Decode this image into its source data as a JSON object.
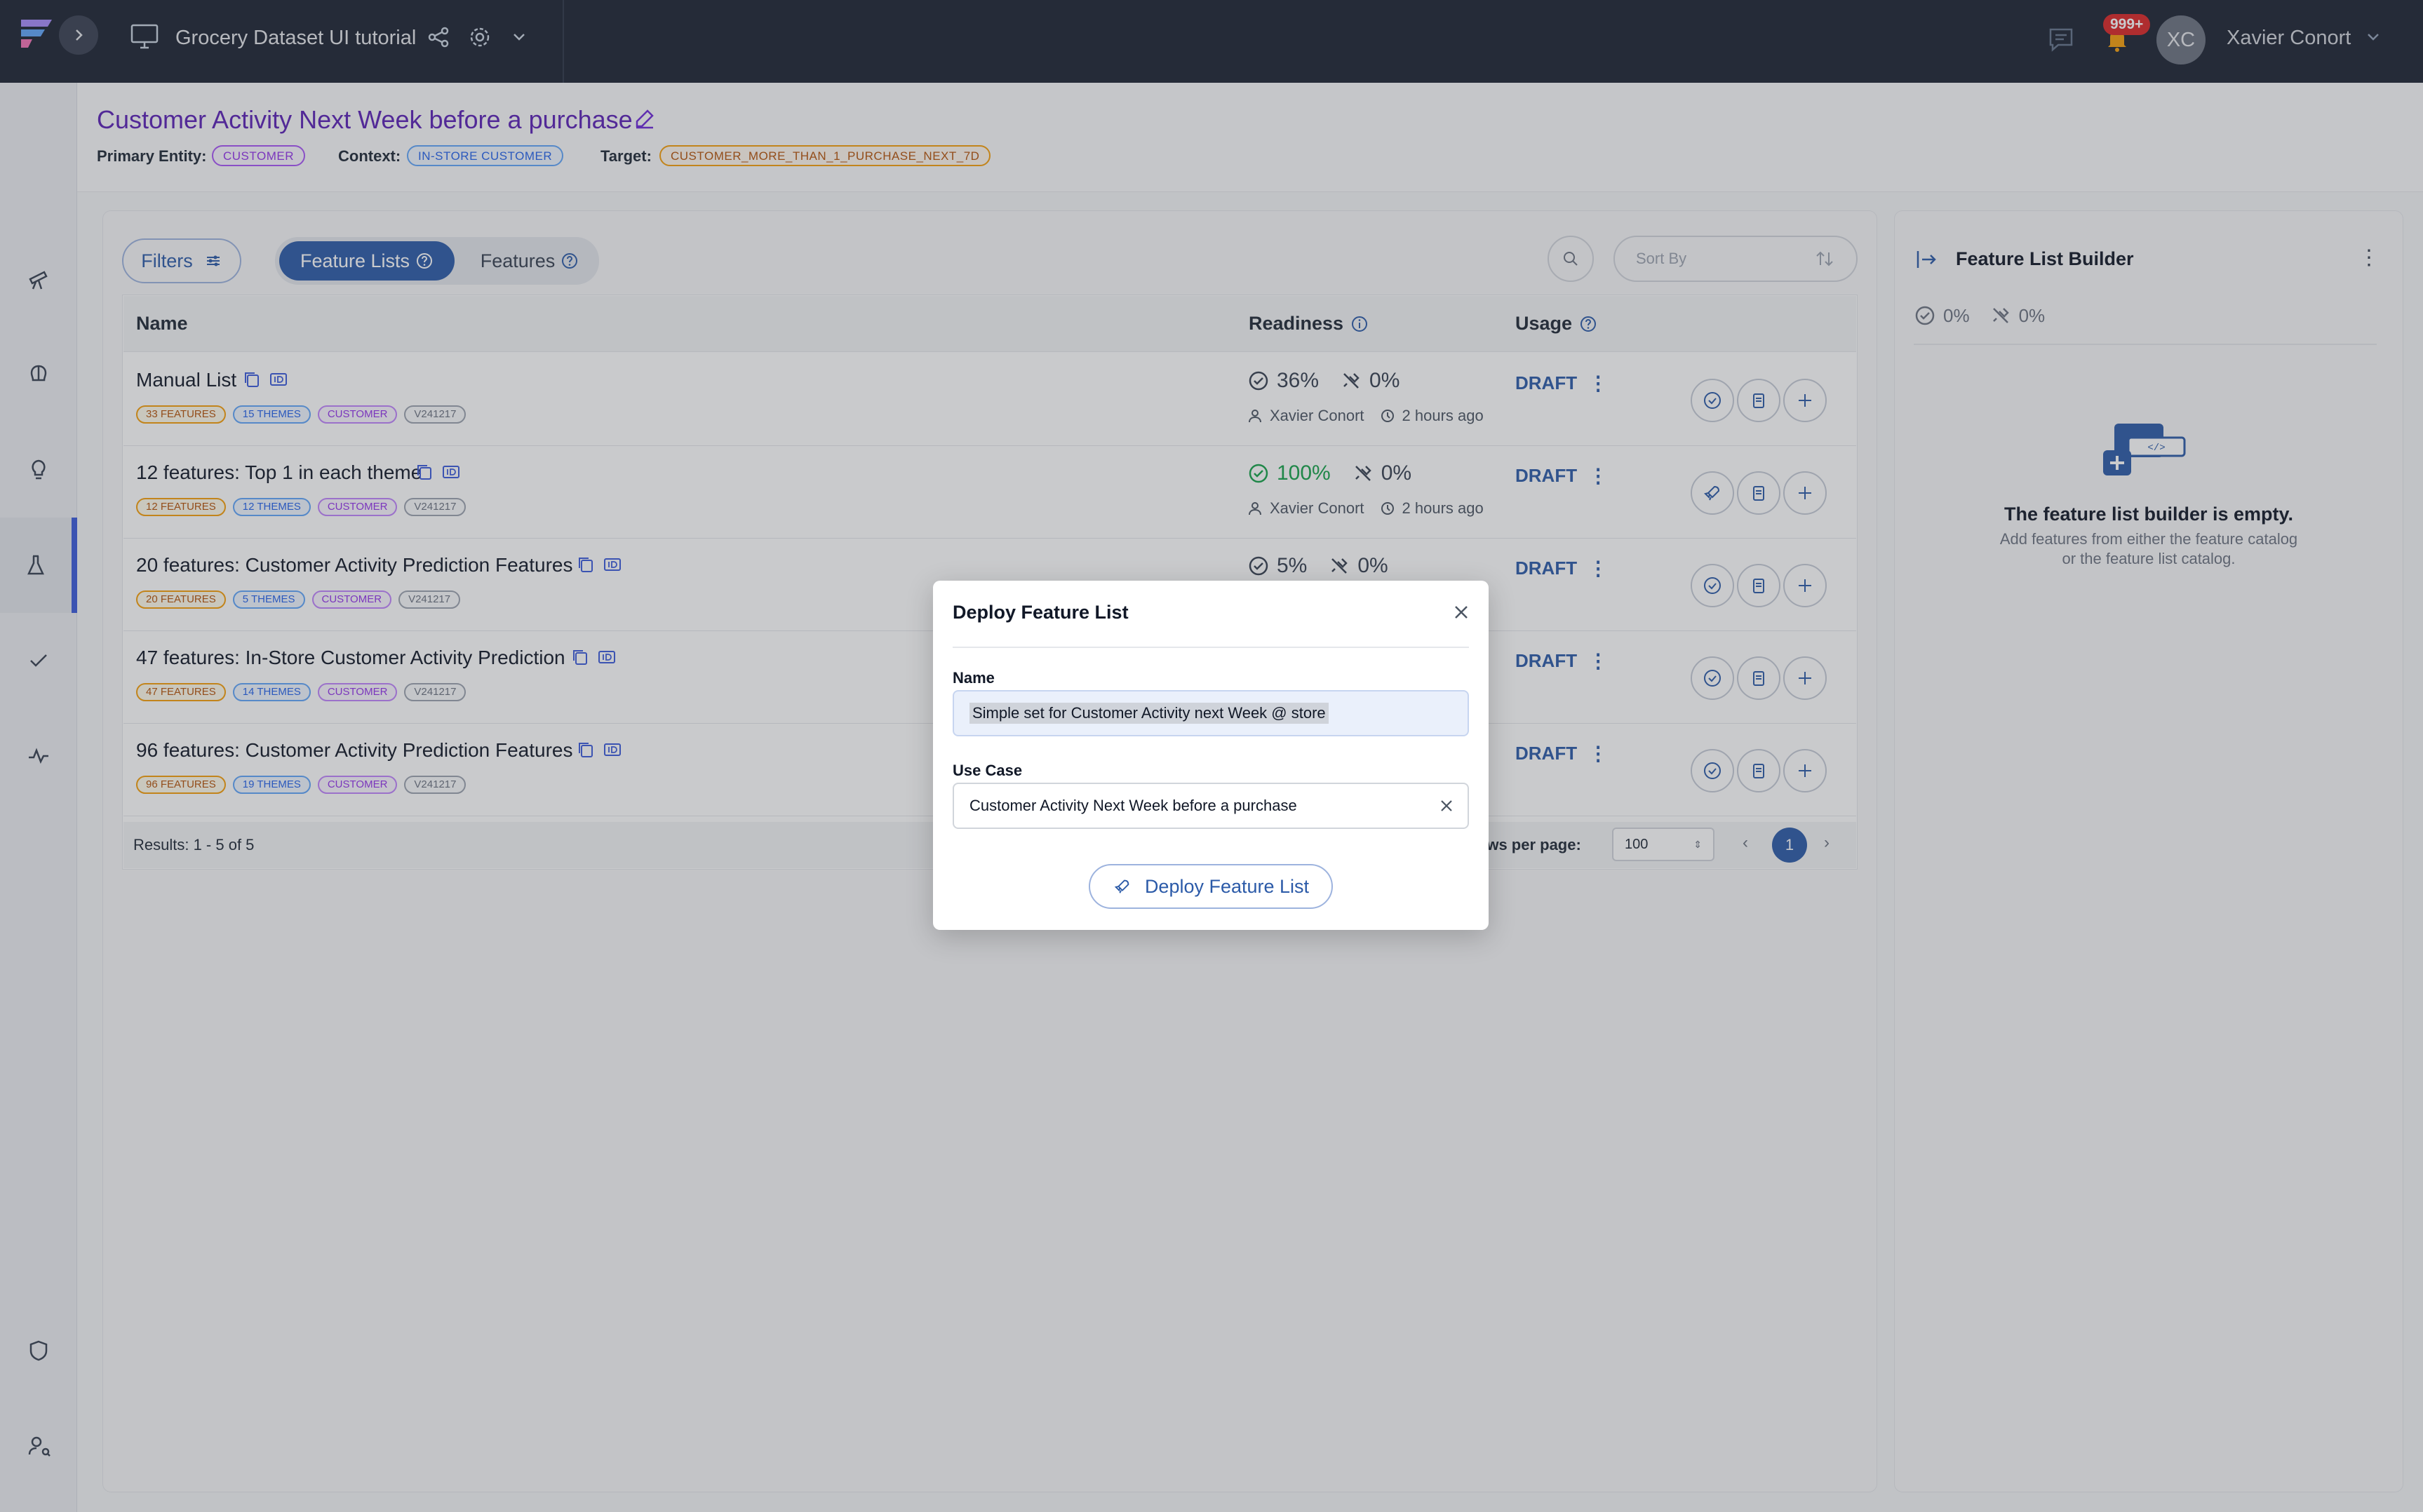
{
  "topbar": {
    "project_title": "Grocery Dataset UI tutorial",
    "notification_count": "999+",
    "avatar_initials": "XC",
    "user_name": "Xavier Conort"
  },
  "page": {
    "title": "Customer Activity Next Week before a purchase",
    "primary_entity_label": "Primary Entity:",
    "primary_entity": "CUSTOMER",
    "context_label": "Context:",
    "context": "IN-STORE CUSTOMER",
    "target_label": "Target:",
    "target": "CUSTOMER_MORE_THAN_1_PURCHASE_NEXT_7D"
  },
  "toolbar": {
    "filters_label": "Filters",
    "tab_feature_lists": "Feature Lists",
    "tab_features": "Features",
    "sort_placeholder": "Sort By"
  },
  "table": {
    "headers": {
      "name": "Name",
      "readiness": "Readiness",
      "usage": "Usage"
    },
    "rows": [
      {
        "name": "Manual List",
        "features": "33 FEATURES",
        "themes": "15 THEMES",
        "entity": "CUSTOMER",
        "version": "V241217",
        "readiness": "36%",
        "online": "0%",
        "author": "Xavier Conort",
        "time": "2 hours ago",
        "usage": "DRAFT"
      },
      {
        "name": "12 features: Top 1 in each theme",
        "features": "12 FEATURES",
        "themes": "12 THEMES",
        "entity": "CUSTOMER",
        "version": "V241217",
        "readiness": "100%",
        "online": "0%",
        "author": "Xavier Conort",
        "time": "2 hours ago",
        "usage": "DRAFT"
      },
      {
        "name": "20 features: Customer Activity Prediction Features",
        "features": "20 FEATURES",
        "themes": "5 THEMES",
        "entity": "CUSTOMER",
        "version": "V241217",
        "readiness": "5%",
        "online": "0%",
        "author": "",
        "time": "",
        "usage": "DRAFT"
      },
      {
        "name": "47 features: In-Store Customer Activity Prediction",
        "features": "47 FEATURES",
        "themes": "14 THEMES",
        "entity": "CUSTOMER",
        "version": "V241217",
        "readiness": "",
        "online": "",
        "author": "",
        "time": "",
        "usage": "DRAFT"
      },
      {
        "name": "96 features: Customer Activity Prediction Features",
        "features": "96 FEATURES",
        "themes": "19 THEMES",
        "entity": "CUSTOMER",
        "version": "V241217",
        "readiness": "",
        "online": "",
        "author": "",
        "time": "",
        "usage": "DRAFT"
      }
    ],
    "results": "Results: 1 - 5 of 5",
    "rows_per_page_label": "Rows per page:",
    "rows_per_page": "100",
    "current_page": "1"
  },
  "builder": {
    "title": "Feature List Builder",
    "readiness": "0%",
    "online": "0%",
    "empty_title": "The feature list builder is empty.",
    "empty_line1": "Add features from either the feature catalog",
    "empty_line2": "or the feature list catalog."
  },
  "modal": {
    "title": "Deploy Feature List",
    "name_label": "Name",
    "name_value": "Simple set for Customer Activity next Week @ store",
    "use_case_label": "Use Case",
    "use_case_value": "Customer Activity Next Week before a purchase",
    "deploy_button": "Deploy Feature List"
  }
}
